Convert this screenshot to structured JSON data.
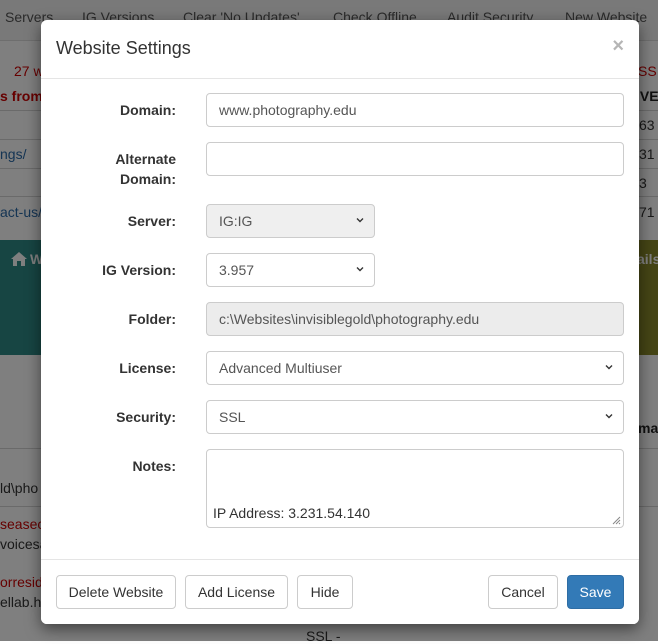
{
  "background": {
    "nav": [
      "Servers",
      "IG Versions",
      "Clear 'No Updates'",
      "Check Offline",
      "Audit Security",
      "New Website"
    ],
    "fragments": {
      "count": "27 w",
      "from": "s from",
      "ssl_r": "SS",
      "ive": "IVE",
      "n63": "63",
      "n31": "31",
      "n3": "3",
      "n71": "71",
      "ngs": "ngs/",
      "contact": "act-us/",
      "w": "W",
      "ails": "ails",
      "mail": "mail",
      "gold": "ld\\pho",
      "seasect": "seasect",
      "voices": "voicesa",
      "corr": "orresid",
      "lab": "ellab.ho",
      "ssl_bottom": "SSL -"
    }
  },
  "modal": {
    "title": "Website Settings",
    "close": "×",
    "fields": {
      "domain": {
        "label": "Domain:",
        "value": "www.photography.edu"
      },
      "alternate_domain": {
        "label_line1": "Alternate",
        "label_line2": "Domain:",
        "value": ""
      },
      "server": {
        "label": "Server:",
        "value": "IG:IG"
      },
      "ig_version": {
        "label": "IG Version:",
        "value": "3.957"
      },
      "folder": {
        "label": "Folder:",
        "value": "c:\\Websites\\invisiblegold\\photography.edu"
      },
      "license": {
        "label": "License:",
        "value": "Advanced Multiuser"
      },
      "security": {
        "label": "Security:",
        "value": "SSL"
      },
      "notes": {
        "label": "Notes:",
        "value": ""
      }
    },
    "ip_address": "IP Address: 3.231.54.140",
    "buttons": {
      "delete": "Delete Website",
      "add_license": "Add License",
      "hide": "Hide",
      "cancel": "Cancel",
      "save": "Save"
    }
  },
  "colors": {
    "primary": "#337ab7",
    "teal": "#2f8a86",
    "olive": "#8a8a2a",
    "alert_red": "#cc0000",
    "link_blue": "#2a6aa8"
  },
  "icons": {
    "home": "home-icon",
    "chevron": "chevron-down-icon",
    "resize": "resize-grip-icon"
  }
}
